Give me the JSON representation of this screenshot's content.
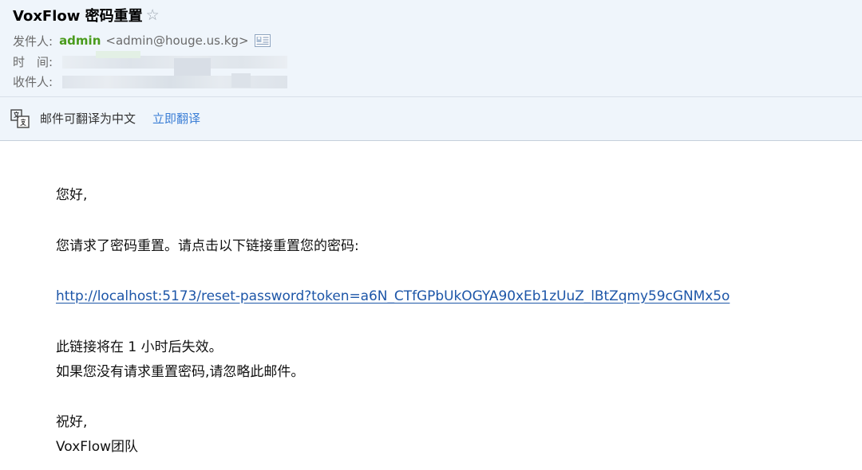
{
  "email": {
    "subject": "VoxFlow 密码重置",
    "star_icon": "star-outline-icon",
    "from_label": "发件人:",
    "sender_name": "admin",
    "sender_address": "<admin@houge.us.kg>",
    "contact_icon": "contact-card-icon",
    "time_label": "时　间:",
    "to_label": "收件人:"
  },
  "translate_bar": {
    "icon": "translate-icon",
    "message": "邮件可翻译为中文",
    "action_label": "立即翻译"
  },
  "body": {
    "greeting": "您好,",
    "intro": "您请求了密码重置。请点击以下链接重置您的密码:",
    "reset_link": "http://localhost:5173/reset-password?token=a6N_CTfGPbUkOGYA90xEb1zUuZ_lBtZqmy59cGNMx5o",
    "expiry": "此链接将在 1 小时后失效。",
    "ignore_note": "如果您没有请求重置密码,请忽略此邮件。",
    "closing": "祝好,",
    "signature": "VoxFlow团队"
  },
  "colors": {
    "header_bg": "#eff5fb",
    "sender_name": "#4a9b1c",
    "link": "#1d56a8",
    "translate_action": "#3c7fd6"
  }
}
